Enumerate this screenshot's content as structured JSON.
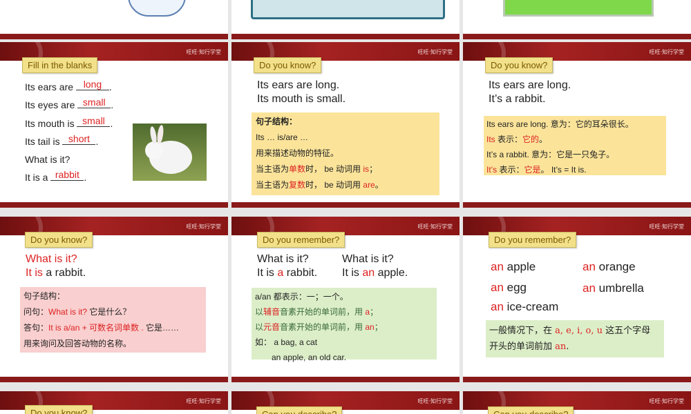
{
  "brand": "旺旺·知行学堂",
  "s1": {
    "title": "Fill in the blanks",
    "lines": [
      {
        "pre": "Its ears are ",
        "blank": "long",
        "post": "."
      },
      {
        "pre": "Its eyes are ",
        "blank": "small",
        "post": "."
      },
      {
        "pre": "Its mouth is ",
        "blank": "small",
        "post": "."
      },
      {
        "pre": "Its tail is ",
        "blank": "short",
        "post": "."
      },
      {
        "pre": "What is it?",
        "blank": "",
        "post": ""
      },
      {
        "pre": "It is a ",
        "blank": "rabbit",
        "post": "."
      }
    ]
  },
  "s2": {
    "title": "Do you know?",
    "l1": "Its ears are long.",
    "l2": "Its mouth is small.",
    "box_h": "句子结构：",
    "box_1": "Its … is/are …",
    "box_2": "用来描述动物的特征。",
    "box_3a": "当主语为",
    "box_3b": "单数",
    "box_3c": "时， be 动词用 ",
    "box_3d": "is",
    "box_3e": "；",
    "box_4a": "当主语为",
    "box_4b": "复数",
    "box_4c": "时， be 动词用 ",
    "box_4d": "are",
    "box_4e": "。"
  },
  "s3": {
    "title": "Do you know?",
    "l1": "Its ears are long.",
    "l2": "It’s a rabbit.",
    "b1": "Its ears are long.  意为：它的耳朵很长。",
    "b2a": "Its",
    "b2b": " 表示：",
    "b2c": "它的",
    "b2d": "。",
    "b3": "It’s a rabbit.  意为：它是一只兔子。",
    "b4a": "It’s",
    "b4b": " 表示：",
    "b4c": "它是",
    "b4d": "。  It’s = It is."
  },
  "s4": {
    "title": "Do you know?",
    "l1": "What is it?",
    "l2a": "It is",
    "l2b": " a rabbit.",
    "b1": "句子结构：",
    "b2a": "问句：",
    "b2b": "What is it?",
    "b2c": "  它是什么？",
    "b3a": "答句：",
    "b3b": "It is a/an + 可数名词单数 .",
    "b3c": "  它是……",
    "b4": "用来询问及回答动物的名称。"
  },
  "s5": {
    "title": "Do you remember?",
    "c1a": "What is it?",
    "c1b1": "It is ",
    "c1b2": "a",
    "c1b3": " rabbit.",
    "c2a": "What is it?",
    "c2b1": "It is ",
    "c2b2": "an",
    "c2b3": " apple.",
    "b1": "a/an 都表示：一；一个。",
    "b2a": "以",
    "b2b": "辅音",
    "b2c": "音素开始的单词前，用 ",
    "b2d": "a",
    "b2e": "；",
    "b3a": "以",
    "b3b": "元音",
    "b3c": "音素开始的单词前，用 ",
    "b3d": "an",
    "b3e": "；",
    "b4": "如：  a bag, a cat",
    "b5": "an apple, an old car."
  },
  "s6": {
    "title": "Do you remember?",
    "words": [
      {
        "art": "an",
        "w": " apple"
      },
      {
        "art": "an",
        "w": " orange"
      },
      {
        "art": "an",
        "w": " egg"
      },
      {
        "art": "an",
        "w": " umbrella"
      },
      {
        "art": "an",
        "w": " ice-cream"
      }
    ],
    "b1a": "一般情况下，在 ",
    "b1b": "a, e, i, o, u",
    "b1c": " 这五个字母",
    "b2a": "开头的单词前加 ",
    "b2b": "an",
    "b2c": "."
  },
  "bottom_titles": [
    "Do you know?",
    "Can you describe?",
    "Can you describe?"
  ],
  "colors": {
    "red": "#dd2222",
    "bar": "#8a1a1a",
    "tag": "#f2e08a"
  }
}
